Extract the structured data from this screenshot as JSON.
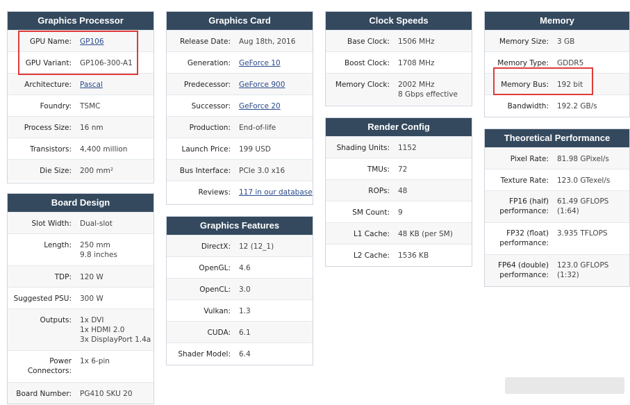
{
  "graphics_processor": {
    "title": "Graphics Processor",
    "rows": [
      {
        "label": "GPU Name:",
        "value": "GP106",
        "link": true
      },
      {
        "label": "GPU Variant:",
        "value": "GP106-300-A1"
      },
      {
        "label": "Architecture:",
        "value": "Pascal",
        "link": true
      },
      {
        "label": "Foundry:",
        "value": "TSMC"
      },
      {
        "label": "Process Size:",
        "value": "16 nm"
      },
      {
        "label": "Transistors:",
        "value": "4,400 million"
      },
      {
        "label": "Die Size:",
        "value": "200 mm²"
      }
    ]
  },
  "board_design": {
    "title": "Board Design",
    "rows": [
      {
        "label": "Slot Width:",
        "value": "Dual-slot"
      },
      {
        "label": "Length:",
        "value": "250 mm\n9.8 inches"
      },
      {
        "label": "TDP:",
        "value": "120 W"
      },
      {
        "label": "Suggested PSU:",
        "value": "300 W"
      },
      {
        "label": "Outputs:",
        "value": "1x DVI\n1x HDMI 2.0\n3x DisplayPort 1.4a"
      },
      {
        "label": "Power\nConnectors:",
        "value": "1x 6-pin"
      },
      {
        "label": "Board Number:",
        "value": "PG410 SKU 20"
      }
    ]
  },
  "graphics_card": {
    "title": "Graphics Card",
    "rows": [
      {
        "label": "Release Date:",
        "value": "Aug 18th, 2016"
      },
      {
        "label": "Generation:",
        "value": "GeForce 10",
        "link": true
      },
      {
        "label": "Predecessor:",
        "value": "GeForce 900",
        "link": true
      },
      {
        "label": "Successor:",
        "value": "GeForce 20",
        "link": true
      },
      {
        "label": "Production:",
        "value": "End-of-life"
      },
      {
        "label": "Launch Price:",
        "value": "199 USD"
      },
      {
        "label": "Bus Interface:",
        "value": "PCIe 3.0 x16"
      },
      {
        "label": "Reviews:",
        "value": "117 in our database",
        "link": true
      }
    ]
  },
  "graphics_features": {
    "title": "Graphics Features",
    "rows": [
      {
        "label": "DirectX:",
        "value": "12 (12_1)"
      },
      {
        "label": "OpenGL:",
        "value": "4.6"
      },
      {
        "label": "OpenCL:",
        "value": "3.0"
      },
      {
        "label": "Vulkan:",
        "value": "1.3"
      },
      {
        "label": "CUDA:",
        "value": "6.1"
      },
      {
        "label": "Shader Model:",
        "value": "6.4"
      }
    ]
  },
  "clock_speeds": {
    "title": "Clock Speeds",
    "rows": [
      {
        "label": "Base Clock:",
        "value": "1506 MHz"
      },
      {
        "label": "Boost Clock:",
        "value": "1708 MHz"
      },
      {
        "label": "Memory Clock:",
        "value": "2002 MHz\n8 Gbps effective"
      }
    ]
  },
  "render_config": {
    "title": "Render Config",
    "rows": [
      {
        "label": "Shading Units:",
        "value": "1152"
      },
      {
        "label": "TMUs:",
        "value": "72"
      },
      {
        "label": "ROPs:",
        "value": "48"
      },
      {
        "label": "SM Count:",
        "value": "9"
      },
      {
        "label": "L1 Cache:",
        "value": "48 KB (per SM)"
      },
      {
        "label": "L2 Cache:",
        "value": "1536 KB"
      }
    ]
  },
  "memory": {
    "title": "Memory",
    "rows": [
      {
        "label": "Memory Size:",
        "value": "3 GB"
      },
      {
        "label": "Memory Type:",
        "value": "GDDR5"
      },
      {
        "label": "Memory Bus:",
        "value": "192 bit"
      },
      {
        "label": "Bandwidth:",
        "value": "192.2 GB/s"
      }
    ]
  },
  "theoretical_performance": {
    "title": "Theoretical Performance",
    "rows": [
      {
        "label": "Pixel Rate:",
        "value": "81.98 GPixel/s"
      },
      {
        "label": "Texture Rate:",
        "value": "123.0 GTexel/s"
      },
      {
        "label": "FP16 (half)\nperformance:",
        "value": "61.49 GFLOPS (1:64)"
      },
      {
        "label": "FP32 (float)\nperformance:",
        "value": "3.935 TFLOPS"
      },
      {
        "label": "FP64 (double)\nperformance:",
        "value": "123.0 GFLOPS (1:32)"
      }
    ]
  },
  "colors": {
    "header": "#34495e",
    "highlight": "#e03a3a",
    "link": "#2a4a8a"
  }
}
